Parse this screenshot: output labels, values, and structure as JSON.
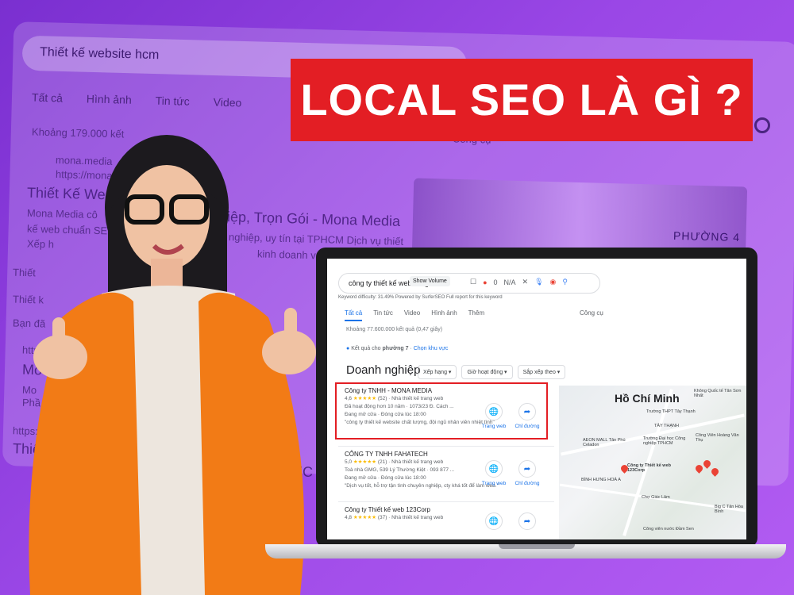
{
  "headline": "LOCAL SEO LÀ GÌ ?",
  "background": {
    "search_query": "Thiết kế website hcm",
    "tabs": [
      "Tất cả",
      "Hình ảnh",
      "Tin tức",
      "Video"
    ],
    "results_count": "Khoảng 179.000 kết",
    "tools": "Công cụ",
    "site_name": "mona.media",
    "site_url": "https://mona.",
    "result_title": "Thiết Kế We",
    "result_title_tail": "iệp, Trọn Gói - Mona Media",
    "snippet_1": "Mona Media cô",
    "snippet_1_tail": "nghiệp, uy tín tại TPHCM Dịch vụ thiết",
    "snippet_2": "kế web chuẩn SE",
    "snippet_2_tail": "kinh doanh với websit",
    "rating_text": "Xếp h",
    "left_lines": [
      "Thiết",
      "Thiết k",
      "Bạn đã",
      "https://",
      "Mo",
      "Mo",
      "Phầ",
      "https://mo",
      "Thiết k"
    ],
    "tail_text": "uẩn SEC",
    "ward": "PHƯỜNG 4"
  },
  "screen": {
    "query": "công ty thiết kế website gần đó",
    "show_volume": "Show Volume",
    "counter": "0",
    "na": "N/A",
    "keyword_line": "Keyword difficulty: 31.49%  Powered by SurferSEO  Full report for this keyword",
    "tabs": [
      {
        "label": "Tất cả",
        "active": true
      },
      {
        "label": "Tin tức",
        "active": false
      },
      {
        "label": "Video",
        "active": false
      },
      {
        "label": "Hình ảnh",
        "active": false
      },
      {
        "label": "Thêm",
        "active": false
      }
    ],
    "tools": "Công cụ",
    "stats": "Khoảng 77.600.000 kết quả (0,47 giây)",
    "location_prefix": "Kết quả cho",
    "location_name": "phường 7",
    "location_link": "Chọn khu vực",
    "business_heading": "Doanh nghiệp",
    "filters": [
      "Xếp hạng ▾",
      "Giờ hoạt động ▾",
      "Sắp xếp theo ▾"
    ],
    "listings": [
      {
        "name": "Công ty TNHH - MONA MEDIA",
        "rating": "4,6",
        "stars": "★★★★★",
        "count": "(52)",
        "category": "Nhà thiết kế trang web",
        "line2": "Đã hoạt động hơn 10 năm · 1073/23 Đ. Cách ...",
        "hours": "Đang mở cửa · Đóng cửa lúc 18:00",
        "review": "\"công ty thiết kế website chất lượng, đội ngũ nhân viên nhiệt tình\""
      },
      {
        "name": "CÔNG TY TNHH FAHATECH",
        "rating": "5,0",
        "stars": "★★★★★",
        "count": "(21)",
        "category": "Nhà thiết kế trang web",
        "line2": "Toà nhà GMG, 539 Lý Thường Kiệt · 093 877 ...",
        "hours": "Đang mở cửa · Đóng cửa lúc 18:00",
        "review": "\"Dịch vụ tốt, hỗ trợ tận tình chuyên nghiệp, cty khá tốt để làm web.\""
      },
      {
        "name": "Công ty Thiết kế web 123Corp",
        "rating": "4,8",
        "stars": "★★★★★",
        "count": "(37)",
        "category": "Nhà thiết kế trang web",
        "line2": "",
        "hours": "",
        "review": ""
      }
    ],
    "website_label": "Trang web",
    "directions_label": "Chỉ đường",
    "map": {
      "city": "Hồ Chí Minh",
      "labels": [
        "Không Quốc tế Tân Sơn Nhất",
        "Trường THPT Tây Thạnh",
        "TÂY THẠNH",
        "AEON MALL Tân Phú Celadon",
        "Trường Đại học Công nghiệp TPHCM",
        "Công Viên Hoàng Văn Thụ",
        "Công ty Thiết kế web 123Corp",
        "BÌNH HƯNG HOÀ A",
        "Chợ Giác Lâm",
        "Công viên nước Đầm Sen",
        "Big C Tân Hòa Bình"
      ]
    }
  },
  "colors": {
    "headline_bg": "#e31e24",
    "background": "#9a47e6",
    "accent_link": "#1a73e8"
  }
}
